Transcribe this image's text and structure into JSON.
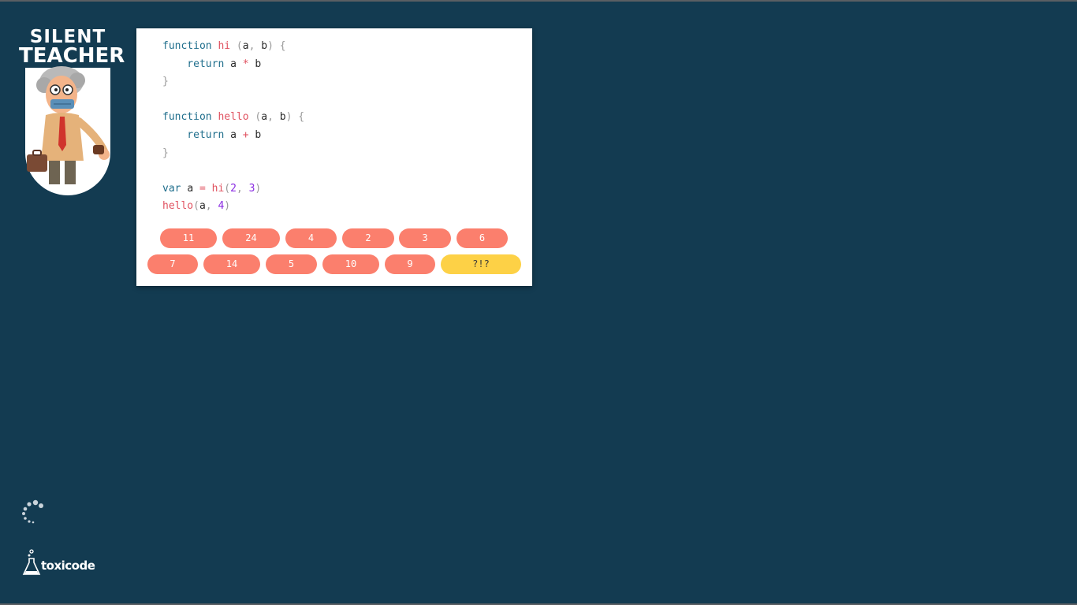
{
  "logo": {
    "line1": "SILENT",
    "line2": "TEACHER"
  },
  "code": {
    "lines": [
      [
        {
          "t": "function ",
          "c": "kw"
        },
        {
          "t": "hi",
          "c": "fn"
        },
        {
          "t": " (",
          "c": "pu"
        },
        {
          "t": "a",
          "c": "va"
        },
        {
          "t": ", ",
          "c": "pu"
        },
        {
          "t": "b",
          "c": "va"
        },
        {
          "t": ") {",
          "c": "pu"
        }
      ],
      [
        {
          "t": "    return ",
          "c": "kw"
        },
        {
          "t": "a",
          "c": "va"
        },
        {
          "t": " * ",
          "c": "op"
        },
        {
          "t": "b",
          "c": "va"
        }
      ],
      [
        {
          "t": "}",
          "c": "pu"
        }
      ],
      [],
      [
        {
          "t": "function ",
          "c": "kw"
        },
        {
          "t": "hello",
          "c": "fn"
        },
        {
          "t": " (",
          "c": "pu"
        },
        {
          "t": "a",
          "c": "va"
        },
        {
          "t": ", ",
          "c": "pu"
        },
        {
          "t": "b",
          "c": "va"
        },
        {
          "t": ") {",
          "c": "pu"
        }
      ],
      [
        {
          "t": "    return ",
          "c": "kw"
        },
        {
          "t": "a",
          "c": "va"
        },
        {
          "t": " + ",
          "c": "op"
        },
        {
          "t": "b",
          "c": "va"
        }
      ],
      [
        {
          "t": "}",
          "c": "pu"
        }
      ],
      [],
      [
        {
          "t": "var ",
          "c": "kw"
        },
        {
          "t": "a",
          "c": "va"
        },
        {
          "t": " = ",
          "c": "op"
        },
        {
          "t": "hi",
          "c": "fn"
        },
        {
          "t": "(",
          "c": "pu"
        },
        {
          "t": "2",
          "c": "nu"
        },
        {
          "t": ", ",
          "c": "pu"
        },
        {
          "t": "3",
          "c": "nu"
        },
        {
          "t": ")",
          "c": "pu"
        }
      ],
      [
        {
          "t": "hello",
          "c": "fn"
        },
        {
          "t": "(",
          "c": "pu"
        },
        {
          "t": "a",
          "c": "va"
        },
        {
          "t": ", ",
          "c": "pu"
        },
        {
          "t": "4",
          "c": "nu"
        },
        {
          "t": ")",
          "c": "pu"
        }
      ]
    ]
  },
  "answers": {
    "row1": [
      "11",
      "24",
      "4",
      "2",
      "3",
      "6"
    ],
    "row2": [
      "7",
      "14",
      "5",
      "10",
      "9",
      "?!?"
    ]
  },
  "footer": {
    "brand": "toxicode"
  },
  "colors": {
    "background": "#133b51",
    "answer_button": "#fb7f6d",
    "special_button": "#fdd146",
    "keyword": "#1f6e8c",
    "function_name": "#e05260"
  },
  "icons": {
    "spinner": "loading-spinner-icon",
    "brand": "flask-icon"
  }
}
